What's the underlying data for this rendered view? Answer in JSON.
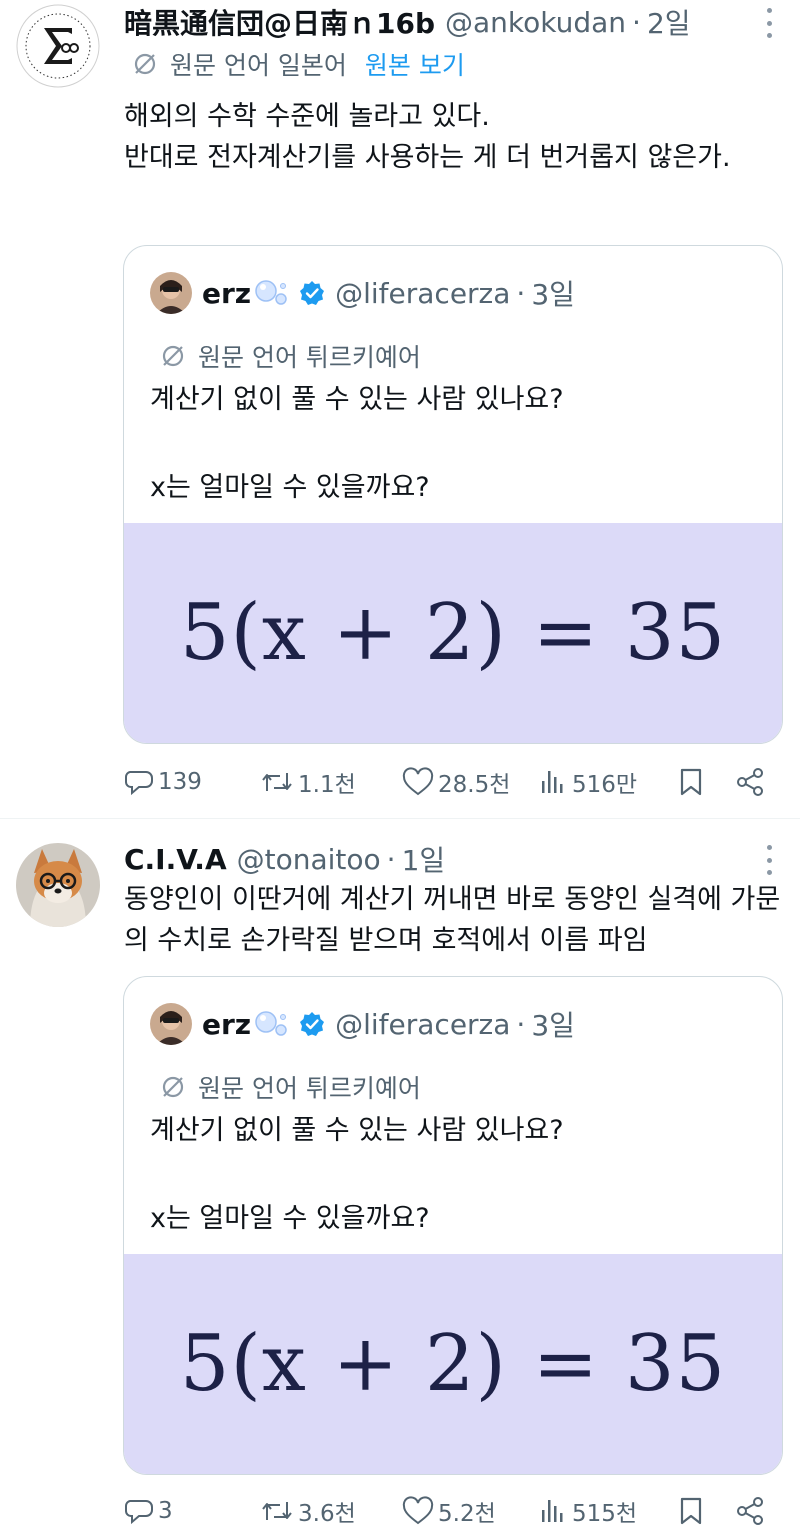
{
  "tweets": [
    {
      "display_name": "暗黒通信団@日南ｎ16b",
      "handle": "@ankokudan",
      "dot": "·",
      "time": "2일",
      "translation_note": "원문 언어 일본어",
      "show_original": "원본 보기",
      "text": "해외의 수학 수준에 놀라고 있다.\n반대로 전자계산기를 사용하는 게 더 번거롭지 않은가.",
      "quote": {
        "display_name": "erz",
        "handle": "@liferacerza",
        "dot": "·",
        "time": "3일",
        "translation_note": "원문 언어 튀르키예어",
        "text": "계산기 없이 풀 수 있는 사람 있나요?\n\nx는 얼마일 수 있을까요?",
        "media_equation": "5(x + 2) = 35"
      },
      "stats": {
        "replies": "139",
        "retweets": "1.1천",
        "likes": "28.5천",
        "views": "516만"
      }
    },
    {
      "display_name": "C.I.V.A",
      "handle": "@tonaitoo",
      "dot": "·",
      "time": "1일",
      "text": "동양인이 이딴거에 계산기 꺼내면 바로 동양인 실격에 가문의 수치로 손가락질 받으며 호적에서 이름 파임",
      "quote": {
        "display_name": "erz",
        "handle": "@liferacerza",
        "dot": "·",
        "time": "3일",
        "translation_note": "원문 언어 튀르키예어",
        "text": "계산기 없이 풀 수 있는 사람 있나요?\n\nx는 얼마일 수 있을까요?",
        "media_equation": "5(x + 2) = 35"
      },
      "stats": {
        "replies": "3",
        "retweets": "3.6천",
        "likes": "5.2천",
        "views": "515천"
      }
    }
  ],
  "icons": {
    "translate": "slashed-circle-icon",
    "verified": "verified-badge-icon",
    "reply": "speech-bubble-icon",
    "retweet": "retweet-arrows-icon",
    "like": "heart-icon",
    "views": "bar-chart-icon",
    "bookmark": "bookmark-icon",
    "share": "share-nodes-icon",
    "more": "vertical-ellipsis-icon"
  },
  "colors": {
    "link": "#1d9bf0",
    "verified": "#1d9bf0",
    "media_bg": "#dcdaf8",
    "muted": "#536471"
  }
}
